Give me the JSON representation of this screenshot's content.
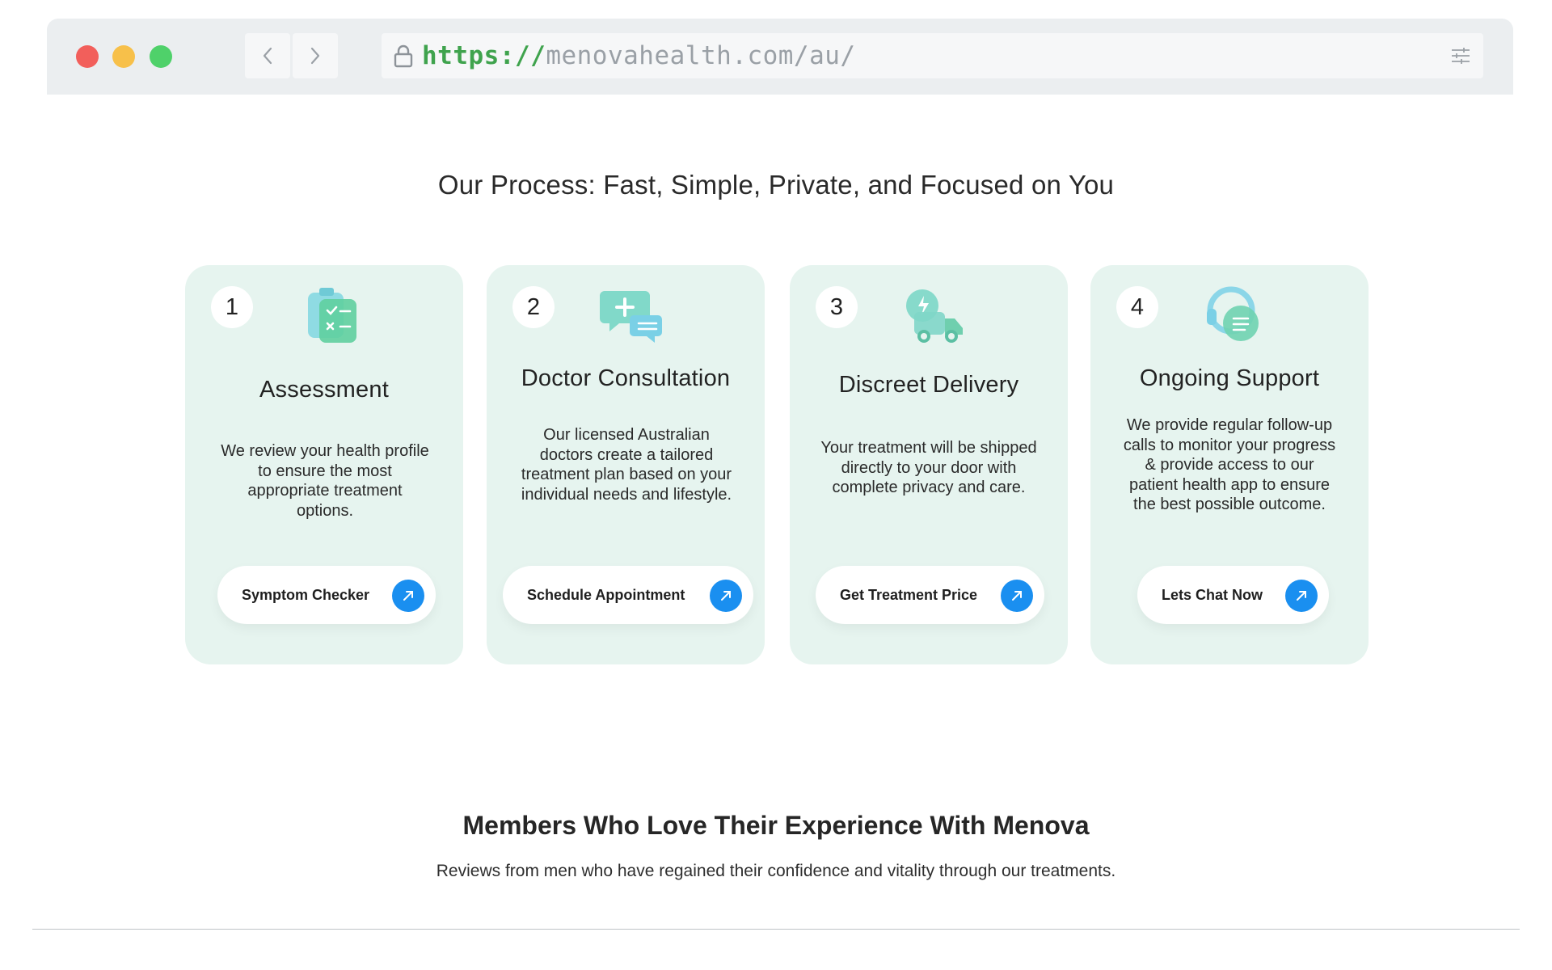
{
  "browser": {
    "url_scheme": "https://",
    "url_host": "menovahealth.com/au/",
    "icons": {
      "back": "chevron-left-icon",
      "forward": "chevron-right-icon",
      "lock": "lock-icon",
      "settings": "sliders-icon"
    }
  },
  "process": {
    "title": "Our Process: Fast, Simple, Private, and Focused on You",
    "cards": [
      {
        "number": "1",
        "title": "Assessment",
        "text": "We review your health profile to ensure the most appropriate treatment options.",
        "button_label": "Symptom Checker",
        "icon": "clipboard-checklist-icon"
      },
      {
        "number": "2",
        "title": "Doctor Consultation",
        "text": "Our licensed Australian doctors create a tailored treatment plan based on your individual needs and lifestyle.",
        "button_label": "Schedule Appointment",
        "icon": "medical-chat-icon"
      },
      {
        "number": "3",
        "title": "Discreet Delivery",
        "text": "Your treatment will be shipped directly to your door with complete privacy and care.",
        "button_label": "Get Treatment Price",
        "icon": "delivery-truck-icon"
      },
      {
        "number": "4",
        "title": "Ongoing Support",
        "text": "We provide regular follow-up calls to monitor your progress & provide access to our patient health app to ensure the best possible outcome.",
        "button_label": "Lets Chat Now",
        "icon": "support-headset-icon"
      }
    ],
    "button_icon": "arrow-up-right-icon"
  },
  "members": {
    "title": "Members Who Love Their Experience With Menova",
    "subtitle": "Reviews from men who have regained their confidence and vitality through our treatments."
  },
  "colors": {
    "card_bg": "#e6f4ef",
    "accent_blue": "#1a8ff0",
    "url_scheme": "#3fa34d",
    "icon_teal": "#6fd3c2"
  }
}
